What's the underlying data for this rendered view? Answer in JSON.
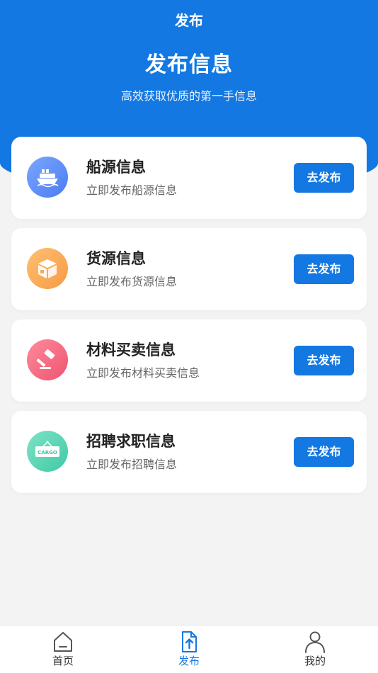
{
  "header": {
    "nav_title": "发布",
    "title": "发布信息",
    "subtitle": "高效获取优质的第一手信息",
    "bg_color": "#1378e1"
  },
  "cards": [
    {
      "title": "船源信息",
      "desc": "立即发布船源信息",
      "button": "去发布",
      "icon": "ship-icon",
      "color": "#5b8ff5"
    },
    {
      "title": "货源信息",
      "desc": "立即发布货源信息",
      "button": "去发布",
      "icon": "package-icon",
      "color": "#f8a756"
    },
    {
      "title": "材料买卖信息",
      "desc": "立即发布材料买卖信息",
      "button": "去发布",
      "icon": "gavel-icon",
      "color": "#f0607a"
    },
    {
      "title": "招聘求职信息",
      "desc": "立即发布招聘信息",
      "button": "去发布",
      "icon": "cargo-sign-icon",
      "color": "#4fd4b2",
      "icon_text": "CARGO"
    }
  ],
  "tabbar": {
    "items": [
      {
        "label": "首页",
        "icon": "home-icon",
        "active": false
      },
      {
        "label": "发布",
        "icon": "publish-file-icon",
        "active": true
      },
      {
        "label": "我的",
        "icon": "user-icon",
        "active": false
      }
    ],
    "active_color": "#1378e1"
  }
}
